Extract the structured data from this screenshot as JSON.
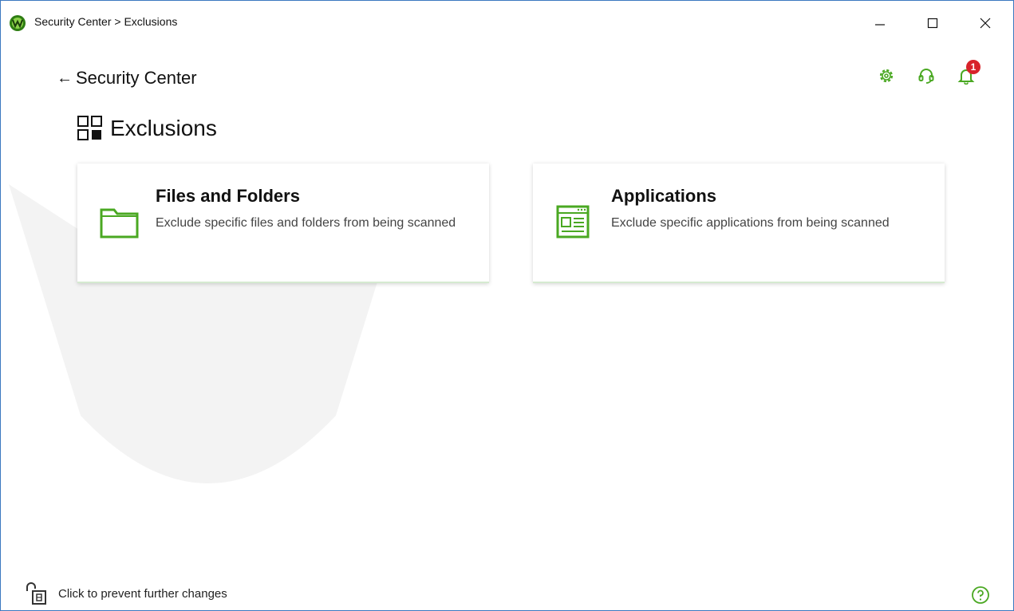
{
  "window": {
    "title": "Security Center > Exclusions",
    "controls": {
      "minimize": "minimize-icon",
      "maximize": "maximize-icon",
      "close": "close-icon"
    }
  },
  "header": {
    "back_arrow": "←",
    "back_label": "Security Center",
    "icons": [
      "gear-icon",
      "support-icon",
      "bell-icon"
    ],
    "notification_count": "1"
  },
  "page": {
    "title": "Exclusions",
    "icon": "grid-icon"
  },
  "cards": [
    {
      "title": "Files and Folders",
      "description": "Exclude specific files and folders from being scanned",
      "icon": "folder-icon"
    },
    {
      "title": "Applications",
      "description": "Exclude specific applications from being scanned",
      "icon": "application-window-icon"
    }
  ],
  "footer": {
    "lock_text": "Click to prevent further changes",
    "lock_icon": "unlocked-padlock-icon",
    "help_icon": "help-icon"
  },
  "colors": {
    "accent": "#4aa822",
    "badge": "#d8232a",
    "window_border": "#3c78c0"
  }
}
